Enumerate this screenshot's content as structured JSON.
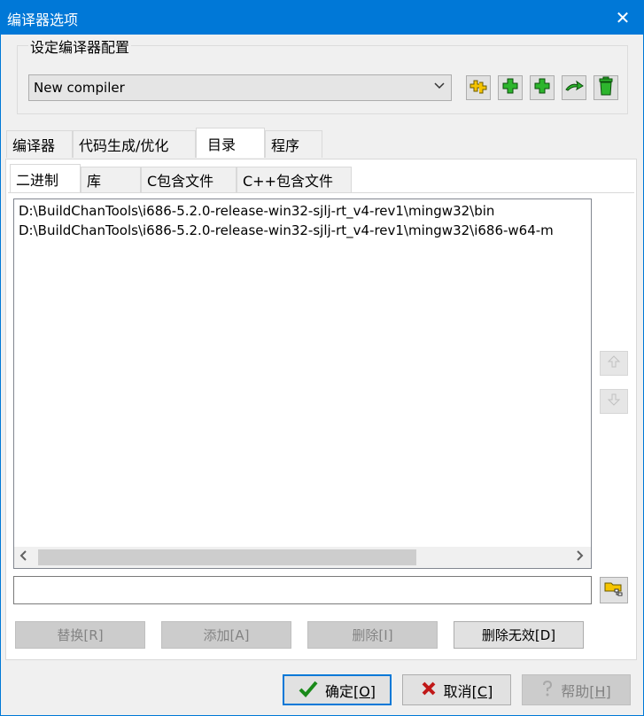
{
  "window": {
    "title": "编译器选项",
    "close_glyph": "✕"
  },
  "compiler_group": {
    "legend": "设定编译器配置",
    "selected_compiler": "New compiler",
    "toolbar_icons": [
      "add-compiler-set-icon",
      "add-icon",
      "add-icon",
      "rename-icon",
      "delete-icon"
    ]
  },
  "main_tabs": [
    {
      "label": "编译器",
      "selected": false
    },
    {
      "label": "代码生成/优化",
      "selected": false
    },
    {
      "label": "目录",
      "selected": true
    },
    {
      "label": "程序",
      "selected": false
    }
  ],
  "dir_tabs": [
    {
      "label": "二进制",
      "selected": true
    },
    {
      "label": "库",
      "selected": false
    },
    {
      "label": "C包含文件",
      "selected": false
    },
    {
      "label": "C++包含文件",
      "selected": false
    }
  ],
  "directory_list": [
    "D:\\BuildChanTools\\i686-5.2.0-release-win32-sjlj-rt_v4-rev1\\mingw32\\bin",
    "D:\\BuildChanTools\\i686-5.2.0-release-win32-sjlj-rt_v4-rev1\\mingw32\\i686-w64-m"
  ],
  "path_input": {
    "value": ""
  },
  "action_buttons": {
    "replace": "替换[R]",
    "add": "添加[A]",
    "delete": "删除[I]",
    "delete_invalid": "删除无效[D]"
  },
  "dialog_buttons": {
    "ok_label": "确定",
    "ok_key": "[O]",
    "cancel_label": "取消",
    "cancel_key": "[C]",
    "help_label": "帮助",
    "help_key": "[H]"
  },
  "colors": {
    "titlebar": "#0078d7",
    "accent": "#0078d7",
    "icon_green": "#2db52d",
    "icon_yellow": "#f5c400"
  }
}
